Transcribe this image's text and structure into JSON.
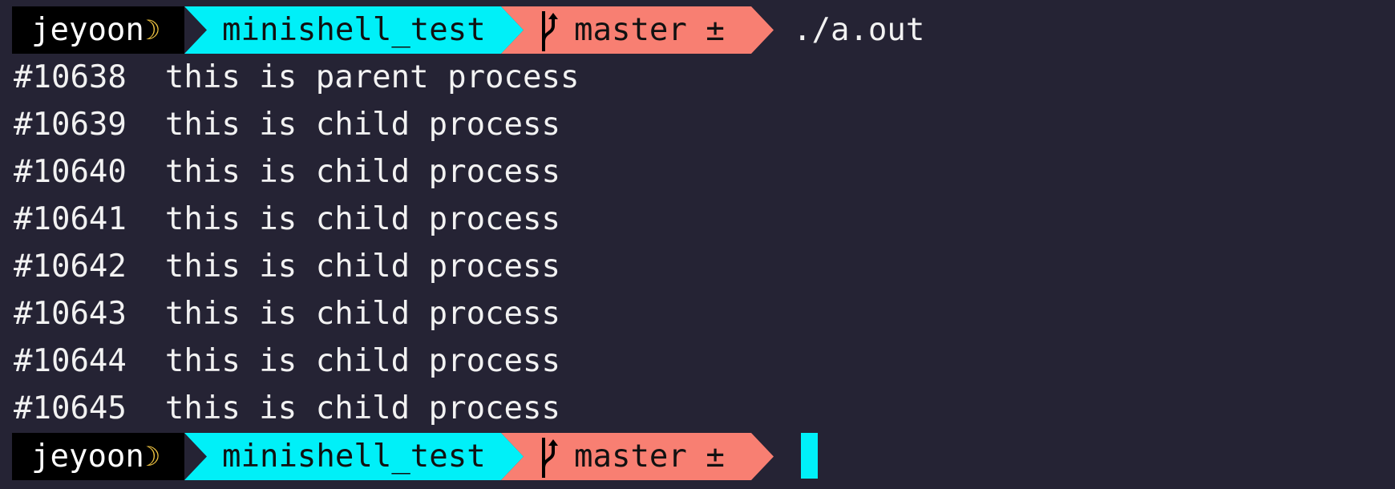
{
  "prompt": {
    "user": "jeyoon",
    "user_icon": "crescent-moon-icon",
    "directory": "minishell_test",
    "branch_icon": "git-branch-icon",
    "branch": "master ±",
    "colors": {
      "user_bg": "#000000",
      "dir_bg": "#00f0f8",
      "git_bg": "#f87f72",
      "background": "#252334"
    }
  },
  "command": "./a.out",
  "output": [
    {
      "pid": "#10638",
      "text": "this is parent process"
    },
    {
      "pid": "#10639",
      "text": "this is child process"
    },
    {
      "pid": "#10640",
      "text": "this is child process"
    },
    {
      "pid": "#10641",
      "text": "this is child process"
    },
    {
      "pid": "#10642",
      "text": "this is child process"
    },
    {
      "pid": "#10643",
      "text": "this is child process"
    },
    {
      "pid": "#10644",
      "text": "this is child process"
    },
    {
      "pid": "#10645",
      "text": "this is child process"
    }
  ]
}
